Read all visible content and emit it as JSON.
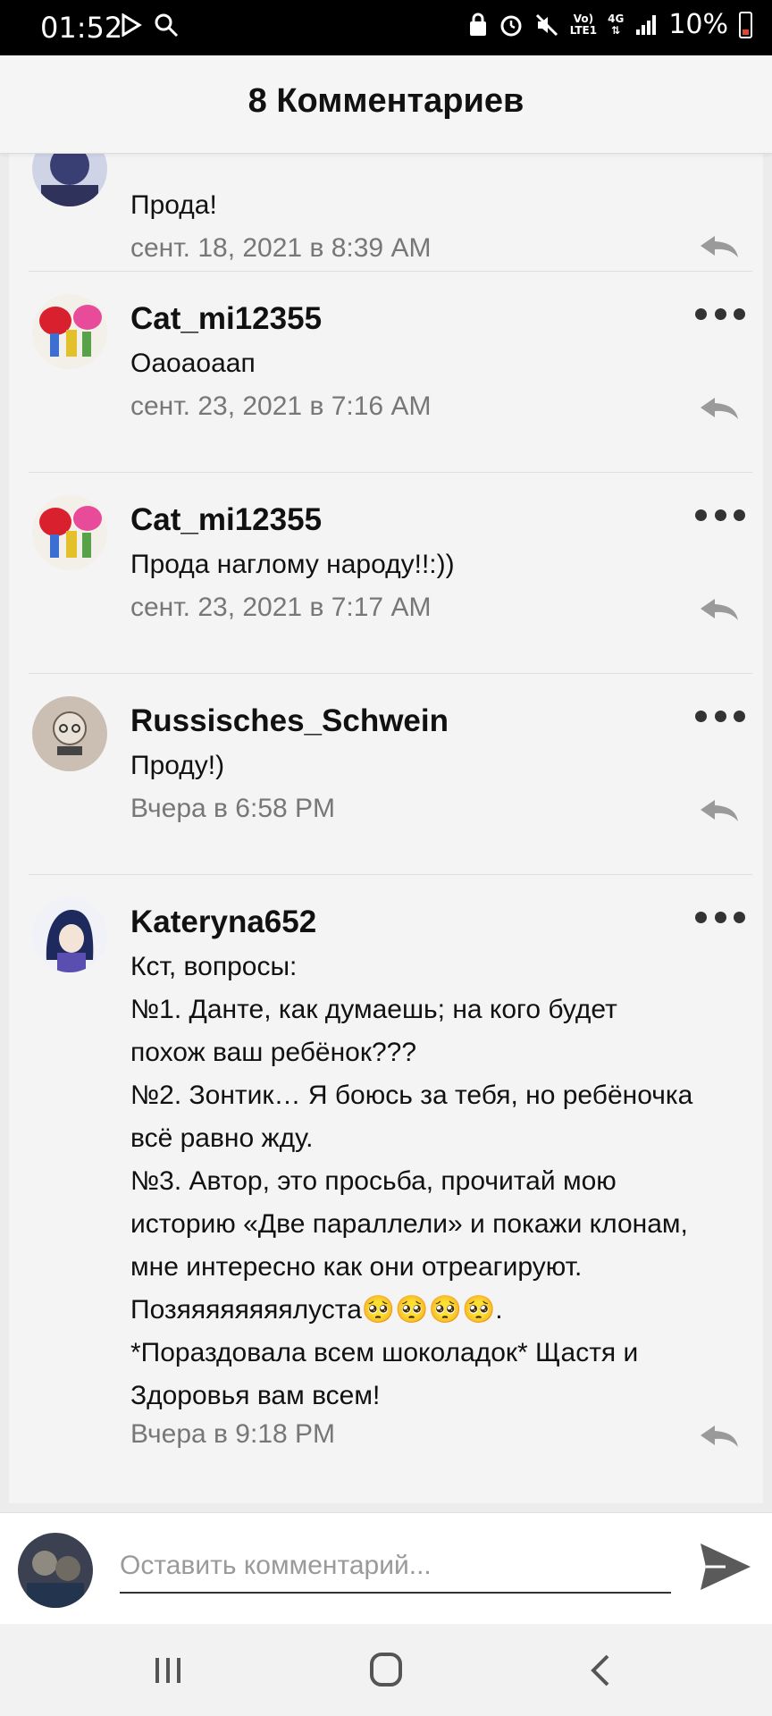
{
  "status_bar": {
    "time": "01:52",
    "network_top": "Vo)",
    "network_bottom": "LTE1",
    "network_gen": "4G",
    "battery_text": "10%"
  },
  "header": {
    "title": "8 Комментариев"
  },
  "comments": [
    {
      "author": "",
      "text": "Прода!",
      "date": "сент. 18, 2021 в 8:39 AM"
    },
    {
      "author": "Cat_mi12355",
      "text": "Оаоаоаап",
      "date": "сент. 23, 2021 в 7:16 AM"
    },
    {
      "author": "Cat_mi12355",
      "text": "Прода наглому народу!!:))",
      "date": "сент. 23, 2021 в 7:17 AM"
    },
    {
      "author": "Russisches_Schwein",
      "text": "Проду!)",
      "date": "Вчера в 6:58 PM"
    },
    {
      "author": "Kateryna652",
      "lines": [
        "Кст, вопросы:",
        "№1. Данте, как думаешь; на кого будет",
        "похож ваш ребёнок???",
        "№2. Зонтик… Я боюсь за тебя, но ребёночка",
        "всё равно жду.",
        "№3. Автор, это просьба, прочитай мою",
        "историю «Две параллели» и покажи клонам,",
        "мне интересно как они отреагируют.",
        "Позяяяяяяяялуста🥺🥺🥺🥺.",
        "*Пораздовала всем шоколадок* Щастя и",
        "Здоровья вам всем!"
      ],
      "date": "Вчера в 9:18 PM"
    }
  ],
  "compose": {
    "placeholder": "Оставить комментарий..."
  },
  "icons": {
    "more": "more-dots-icon",
    "reply": "reply-arrow-icon",
    "send": "send-icon",
    "nav_recents": "recents-icon",
    "nav_home": "home-icon",
    "nav_back": "back-icon"
  },
  "colors": {
    "status_bar": "#000000",
    "header_bg": "#f5f5f5",
    "list_bg": "#f4f4f4",
    "date_text": "#777777",
    "icon_gray": "#9a9a9a",
    "battery_low": "#e0472e"
  }
}
